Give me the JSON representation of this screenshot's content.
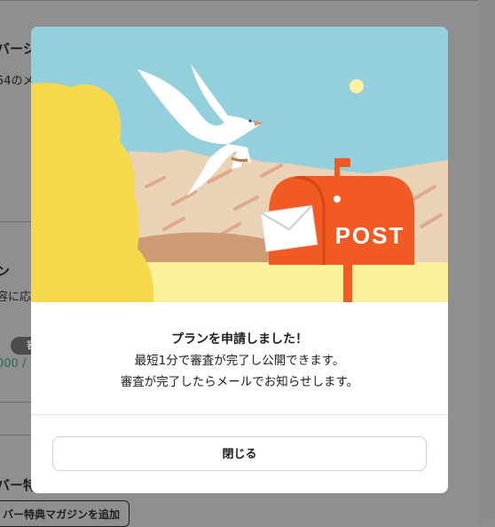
{
  "background": {
    "heading_top": "バーシ",
    "subtext_top": "54のメ",
    "heading_mid": "ン",
    "subtext_mid": "容に応",
    "badge": "審査",
    "price_fragment": "000 /",
    "heading_bottom": "バー特",
    "add_button": "バー特典マガジンを追加"
  },
  "modal": {
    "illustration": {
      "mailbox_label": "POST",
      "colors": {
        "sky": "#94d0dc",
        "mailbox": "#f15a22",
        "bush": "#f6d94a",
        "ground": "#fbf19a",
        "sun": "#fbf0a0"
      }
    },
    "title": "プランを申請しました！",
    "lines": [
      "最短1分で審査が完了し公開できます。",
      "審査が完了したらメールでお知らせします。"
    ],
    "close_label": "閉じる"
  }
}
